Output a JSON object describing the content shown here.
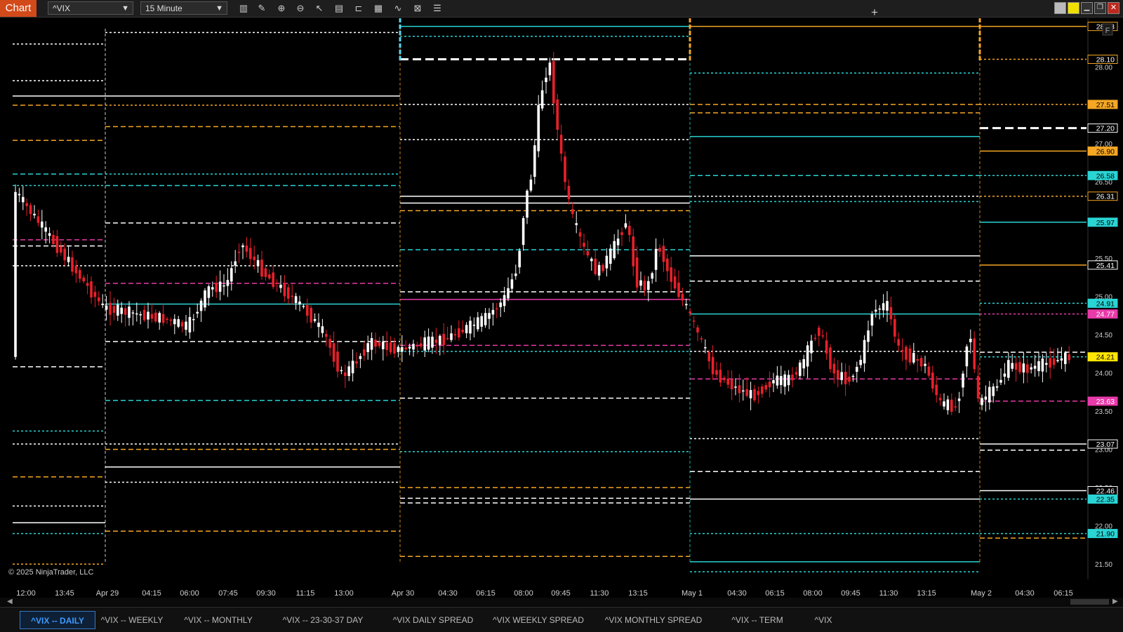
{
  "toolbar": {
    "chart_label": "Chart",
    "instrument": "^VIX",
    "interval": "15 Minute",
    "icons": [
      "bar-type-icon",
      "pencil-icon",
      "zoom-in-icon",
      "zoom-out-icon",
      "pointer-icon",
      "data-box-icon",
      "order-lines-icon",
      "properties-icon",
      "indicators-icon",
      "strategies-icon",
      "list-icon"
    ]
  },
  "copyright": "© 2025 NinjaTrader, LLC",
  "panel_flag": "F",
  "tabs": [
    {
      "label": "^VIX -- DAILY",
      "active": true
    },
    {
      "label": "^VIX -- WEEKLY",
      "active": false
    },
    {
      "label": "^VIX -- MONTHLY",
      "active": false
    },
    {
      "label": "^VIX -- 23-30-37 DAY",
      "active": false
    },
    {
      "label": "^VIX DAILY SPREAD",
      "active": false
    },
    {
      "label": "^VIX WEEKLY SPREAD",
      "active": false
    },
    {
      "label": "^VIX MONTHLY SPREAD",
      "active": false
    },
    {
      "label": "^VIX -- TERM",
      "active": false
    },
    {
      "label": "^VIX",
      "active": false
    }
  ],
  "add_tab_label": "+",
  "colors": {
    "background": "#000000",
    "up_candle": "#ffffff",
    "down_candle": "#e8202a",
    "orange": "#f5a623",
    "cyan": "#2ad4d4",
    "magenta": "#e83aa8",
    "white_line": "#ffffff",
    "session_marker_cyan": "#5ad8f0",
    "session_marker_orange": "#f5a623"
  },
  "chart_data": {
    "type": "candlestick",
    "y_range": [
      21.3,
      28.6
    ],
    "y_ticks": [
      "28.00",
      "27.50",
      "27.00",
      "26.50",
      "26.00",
      "25.50",
      "25.00",
      "24.50",
      "24.00",
      "23.50",
      "23.00",
      "22.50",
      "22.00",
      "21.50"
    ],
    "x_labels": [
      "12:00",
      "13:45",
      "Apr 29",
      "04:15",
      "06:00",
      "07:45",
      "09:30",
      "11:15",
      "13:00",
      "Apr 30",
      "04:30",
      "06:15",
      "08:00",
      "09:45",
      "11:30",
      "13:15",
      "May 1",
      "04:30",
      "06:15",
      "08:00",
      "09:45",
      "11:30",
      "13:15",
      "May 2",
      "04:30",
      "06:15"
    ],
    "price_badges": [
      {
        "value": "28.53",
        "style": "orange-outline"
      },
      {
        "value": "28.10",
        "style": "orange-outline"
      },
      {
        "value": "27.51",
        "style": "orange"
      },
      {
        "value": "27.20",
        "style": "white-outline"
      },
      {
        "value": "26.90",
        "style": "orange"
      },
      {
        "value": "26.58",
        "style": "cyan"
      },
      {
        "value": "26.31",
        "style": "orange-outline"
      },
      {
        "value": "25.97",
        "style": "cyan"
      },
      {
        "value": "25.41",
        "style": "white-outline"
      },
      {
        "value": "24.91",
        "style": "cyan"
      },
      {
        "value": "24.77",
        "style": "magenta"
      },
      {
        "value": "24.21",
        "style": "yellow"
      },
      {
        "value": "23.63",
        "style": "magenta"
      },
      {
        "value": "23.07",
        "style": "white-outline"
      },
      {
        "value": "22.46",
        "style": "white-outline"
      },
      {
        "value": "22.35",
        "style": "cyan"
      },
      {
        "value": "21.90",
        "style": "cyan"
      }
    ],
    "session_markers": [
      {
        "label": "Apr 30",
        "color": "cyan"
      },
      {
        "label": "May 1",
        "color": "orange"
      },
      {
        "label": "May 2",
        "color": "orange"
      }
    ],
    "levels": [
      {
        "segment": 0,
        "color": "white",
        "dash": "dot",
        "y": 28.3
      },
      {
        "segment": 0,
        "color": "white",
        "dash": "dot",
        "y": 27.82
      },
      {
        "segment": 0,
        "color": "white",
        "dash": "solid",
        "y": 27.62
      },
      {
        "segment": 0,
        "color": "orange",
        "dash": "dash",
        "y": 27.5
      },
      {
        "segment": 0,
        "color": "orange",
        "dash": "dash",
        "y": 27.04
      },
      {
        "segment": 0,
        "color": "cyan",
        "dash": "dash",
        "y": 26.6
      },
      {
        "segment": 0,
        "color": "cyan",
        "dash": "dot",
        "y": 26.45
      },
      {
        "segment": 0,
        "color": "magenta",
        "dash": "dash",
        "y": 25.74
      },
      {
        "segment": 0,
        "color": "white",
        "dash": "dash",
        "y": 25.66
      },
      {
        "segment": 0,
        "color": "white",
        "dash": "dot",
        "y": 25.4
      },
      {
        "segment": 0,
        "color": "white",
        "dash": "dash",
        "y": 24.08
      },
      {
        "segment": 0,
        "color": "cyan",
        "dash": "dot",
        "y": 23.24
      },
      {
        "segment": 0,
        "color": "white",
        "dash": "dot",
        "y": 23.07
      },
      {
        "segment": 0,
        "color": "orange",
        "dash": "dash",
        "y": 22.64
      },
      {
        "segment": 0,
        "color": "white",
        "dash": "dot",
        "y": 22.26
      },
      {
        "segment": 0,
        "color": "white",
        "dash": "solid",
        "y": 22.04
      },
      {
        "segment": 0,
        "color": "cyan",
        "dash": "dot",
        "y": 21.9
      },
      {
        "segment": 0,
        "color": "orange",
        "dash": "dot",
        "y": 21.5
      },
      {
        "segment": 1,
        "color": "white",
        "dash": "dot",
        "y": 28.45
      },
      {
        "segment": 1,
        "color": "white",
        "dash": "solid",
        "y": 27.62
      },
      {
        "segment": 1,
        "color": "orange",
        "dash": "dot",
        "y": 27.5
      },
      {
        "segment": 1,
        "color": "orange",
        "dash": "dash",
        "y": 27.22
      },
      {
        "segment": 1,
        "color": "cyan",
        "dash": "dot",
        "y": 26.6
      },
      {
        "segment": 1,
        "color": "cyan",
        "dash": "dash",
        "y": 26.45
      },
      {
        "segment": 1,
        "color": "white",
        "dash": "dash",
        "y": 25.96
      },
      {
        "segment": 1,
        "color": "magenta",
        "dash": "dash",
        "y": 25.17
      },
      {
        "segment": 1,
        "color": "white",
        "dash": "dot",
        "y": 25.4
      },
      {
        "segment": 1,
        "color": "cyan",
        "dash": "solid",
        "y": 24.9
      },
      {
        "segment": 1,
        "color": "white",
        "dash": "dash",
        "y": 24.41
      },
      {
        "segment": 1,
        "color": "cyan",
        "dash": "dash",
        "y": 23.64
      },
      {
        "segment": 1,
        "color": "white",
        "dash": "dot",
        "y": 23.07
      },
      {
        "segment": 1,
        "color": "orange",
        "dash": "dash",
        "y": 23.0
      },
      {
        "segment": 1,
        "color": "white",
        "dash": "solid",
        "y": 22.77
      },
      {
        "segment": 1,
        "color": "white",
        "dash": "dot",
        "y": 22.57
      },
      {
        "segment": 1,
        "color": "orange",
        "dash": "dash",
        "y": 21.93
      },
      {
        "segment": 2,
        "color": "cyan",
        "dash": "solid",
        "y": 28.53
      },
      {
        "segment": 2,
        "color": "cyan",
        "dash": "dot",
        "y": 28.4
      },
      {
        "segment": 2,
        "color": "white",
        "dash": "dash",
        "y": 28.1
      },
      {
        "segment": 2,
        "color": "white",
        "dash": "dot",
        "y": 27.51
      },
      {
        "segment": 2,
        "color": "white",
        "dash": "dot",
        "y": 27.05
      },
      {
        "segment": 2,
        "color": "white",
        "dash": "solid",
        "y": 26.31
      },
      {
        "segment": 2,
        "color": "white",
        "dash": "solid",
        "y": 26.22
      },
      {
        "segment": 2,
        "color": "orange",
        "dash": "dash",
        "y": 26.12
      },
      {
        "segment": 2,
        "color": "cyan",
        "dash": "dash",
        "y": 25.61
      },
      {
        "segment": 2,
        "color": "white",
        "dash": "dash",
        "y": 25.06
      },
      {
        "segment": 2,
        "color": "magenta",
        "dash": "solid",
        "y": 24.96
      },
      {
        "segment": 2,
        "color": "magenta",
        "dash": "dash",
        "y": 24.36
      },
      {
        "segment": 2,
        "color": "cyan",
        "dash": "dot",
        "y": 24.28
      },
      {
        "segment": 2,
        "color": "white",
        "dash": "dash",
        "y": 23.67
      },
      {
        "segment": 2,
        "color": "cyan",
        "dash": "dot",
        "y": 22.97
      },
      {
        "segment": 2,
        "color": "orange",
        "dash": "dash",
        "y": 22.5
      },
      {
        "segment": 2,
        "color": "white",
        "dash": "dash",
        "y": 22.36
      },
      {
        "segment": 2,
        "color": "white",
        "dash": "dash",
        "y": 22.3
      },
      {
        "segment": 2,
        "color": "orange",
        "dash": "dash",
        "y": 21.6
      },
      {
        "segment": 3,
        "color": "orange",
        "dash": "solid",
        "y": 28.53
      },
      {
        "segment": 3,
        "color": "cyan",
        "dash": "dot",
        "y": 27.92
      },
      {
        "segment": 3,
        "color": "orange",
        "dash": "dash",
        "y": 27.51
      },
      {
        "segment": 3,
        "color": "orange",
        "dash": "dash",
        "y": 27.4
      },
      {
        "segment": 3,
        "color": "cyan",
        "dash": "solid",
        "y": 27.09
      },
      {
        "segment": 3,
        "color": "cyan",
        "dash": "dash",
        "y": 26.58
      },
      {
        "segment": 3,
        "color": "white",
        "dash": "dot",
        "y": 26.31
      },
      {
        "segment": 3,
        "color": "cyan",
        "dash": "dot",
        "y": 26.24
      },
      {
        "segment": 3,
        "color": "white",
        "dash": "solid",
        "y": 25.53
      },
      {
        "segment": 3,
        "color": "white",
        "dash": "dash",
        "y": 25.2
      },
      {
        "segment": 3,
        "color": "cyan",
        "dash": "solid",
        "y": 24.77
      },
      {
        "segment": 3,
        "color": "white",
        "dash": "dot",
        "y": 24.28
      },
      {
        "segment": 3,
        "color": "magenta",
        "dash": "dash",
        "y": 23.92
      },
      {
        "segment": 3,
        "color": "white",
        "dash": "dot",
        "y": 23.14
      },
      {
        "segment": 3,
        "color": "white",
        "dash": "dash",
        "y": 22.71
      },
      {
        "segment": 3,
        "color": "white",
        "dash": "solid",
        "y": 22.35
      },
      {
        "segment": 3,
        "color": "cyan",
        "dash": "dot",
        "y": 21.9
      },
      {
        "segment": 3,
        "color": "cyan",
        "dash": "solid",
        "y": 21.53
      },
      {
        "segment": 3,
        "color": "cyan",
        "dash": "dot",
        "y": 21.4
      },
      {
        "segment": 4,
        "color": "orange",
        "dash": "solid",
        "y": 28.53
      },
      {
        "segment": 4,
        "color": "orange",
        "dash": "dot",
        "y": 28.1
      },
      {
        "segment": 4,
        "color": "orange",
        "dash": "dot",
        "y": 27.51
      },
      {
        "segment": 4,
        "color": "white",
        "dash": "dash",
        "y": 27.2
      },
      {
        "segment": 4,
        "color": "orange",
        "dash": "solid",
        "y": 26.9
      },
      {
        "segment": 4,
        "color": "cyan",
        "dash": "dot",
        "y": 26.58
      },
      {
        "segment": 4,
        "color": "orange",
        "dash": "dot",
        "y": 26.31
      },
      {
        "segment": 4,
        "color": "cyan",
        "dash": "solid",
        "y": 25.97
      },
      {
        "segment": 4,
        "color": "orange",
        "dash": "solid",
        "y": 25.41
      },
      {
        "segment": 4,
        "color": "cyan",
        "dash": "dot",
        "y": 24.91
      },
      {
        "segment": 4,
        "color": "magenta",
        "dash": "dot",
        "y": 24.77
      },
      {
        "segment": 4,
        "color": "white",
        "dash": "dash",
        "y": 24.27
      },
      {
        "segment": 4,
        "color": "cyan",
        "dash": "dot",
        "y": 24.21
      },
      {
        "segment": 4,
        "color": "magenta",
        "dash": "dash",
        "y": 23.63
      },
      {
        "segment": 4,
        "color": "white",
        "dash": "solid",
        "y": 23.07
      },
      {
        "segment": 4,
        "color": "white",
        "dash": "dash",
        "y": 22.99
      },
      {
        "segment": 4,
        "color": "white",
        "dash": "solid",
        "y": 22.46
      },
      {
        "segment": 4,
        "color": "cyan",
        "dash": "dot",
        "y": 22.35
      },
      {
        "segment": 4,
        "color": "cyan",
        "dash": "dot",
        "y": 21.9
      },
      {
        "segment": 4,
        "color": "orange",
        "dash": "dash",
        "y": 21.84
      }
    ],
    "anchors": [
      {
        "x": "12:00",
        "y": 26.42
      },
      {
        "x": "Apr 29",
        "y": 24.85
      },
      {
        "x": "05:00",
        "y": 24.7
      },
      {
        "x": "06:00",
        "y": 24.6
      },
      {
        "x": "06:30",
        "y": 25.1
      },
      {
        "x": "07:45",
        "y": 25.15
      },
      {
        "x": "08:30",
        "y": 25.7
      },
      {
        "x": "09:30",
        "y": 25.3
      },
      {
        "x": "11:15",
        "y": 24.85
      },
      {
        "x": "12:15",
        "y": 24.5
      },
      {
        "x": "13:00",
        "y": 23.95
      },
      {
        "x": "13:30",
        "y": 24.1
      },
      {
        "x": "14:30",
        "y": 24.4
      },
      {
        "x": "Apr 30",
        "y": 24.3
      },
      {
        "x": "04:30",
        "y": 24.45
      },
      {
        "x": "06:15",
        "y": 24.7
      },
      {
        "x": "07:00",
        "y": 24.95
      },
      {
        "x": "07:40",
        "y": 25.4
      },
      {
        "x": "08:00",
        "y": 26.2
      },
      {
        "x": "08:30",
        "y": 26.6
      },
      {
        "x": "08:45",
        "y": 27.6
      },
      {
        "x": "09:00",
        "y": 28.1
      },
      {
        "x": "09:15",
        "y": 27.0
      },
      {
        "x": "09:45",
        "y": 26.1
      },
      {
        "x": "10:15",
        "y": 25.6
      },
      {
        "x": "10:45",
        "y": 25.3
      },
      {
        "x": "11:30",
        "y": 25.6
      },
      {
        "x": "12:00",
        "y": 26.0
      },
      {
        "x": "12:30",
        "y": 25.2
      },
      {
        "x": "13:15",
        "y": 25.1
      },
      {
        "x": "13:45",
        "y": 25.7
      },
      {
        "x": "14:15",
        "y": 25.3
      },
      {
        "x": "15:00",
        "y": 24.8
      },
      {
        "x": "May 1",
        "y": 24.0
      },
      {
        "x": "05:00",
        "y": 23.8
      },
      {
        "x": "06:15",
        "y": 23.7
      },
      {
        "x": "07:00",
        "y": 23.9
      },
      {
        "x": "08:00",
        "y": 23.9
      },
      {
        "x": "08:45",
        "y": 24.1
      },
      {
        "x": "09:15",
        "y": 24.6
      },
      {
        "x": "09:45",
        "y": 24.0
      },
      {
        "x": "10:30",
        "y": 23.9
      },
      {
        "x": "11:00",
        "y": 24.2
      },
      {
        "x": "11:30",
        "y": 24.8
      },
      {
        "x": "12:00",
        "y": 24.9
      },
      {
        "x": "12:30",
        "y": 24.3
      },
      {
        "x": "13:15",
        "y": 24.1
      },
      {
        "x": "13:45",
        "y": 23.6
      },
      {
        "x": "14:30",
        "y": 23.55
      },
      {
        "x": "15:00",
        "y": 24.6
      },
      {
        "x": "May 2",
        "y": 23.6
      },
      {
        "x": "04:30",
        "y": 23.8
      },
      {
        "x": "05:15",
        "y": 24.1
      },
      {
        "x": "06:15",
        "y": 24.05
      },
      {
        "x": "07:00",
        "y": 24.21
      }
    ]
  }
}
